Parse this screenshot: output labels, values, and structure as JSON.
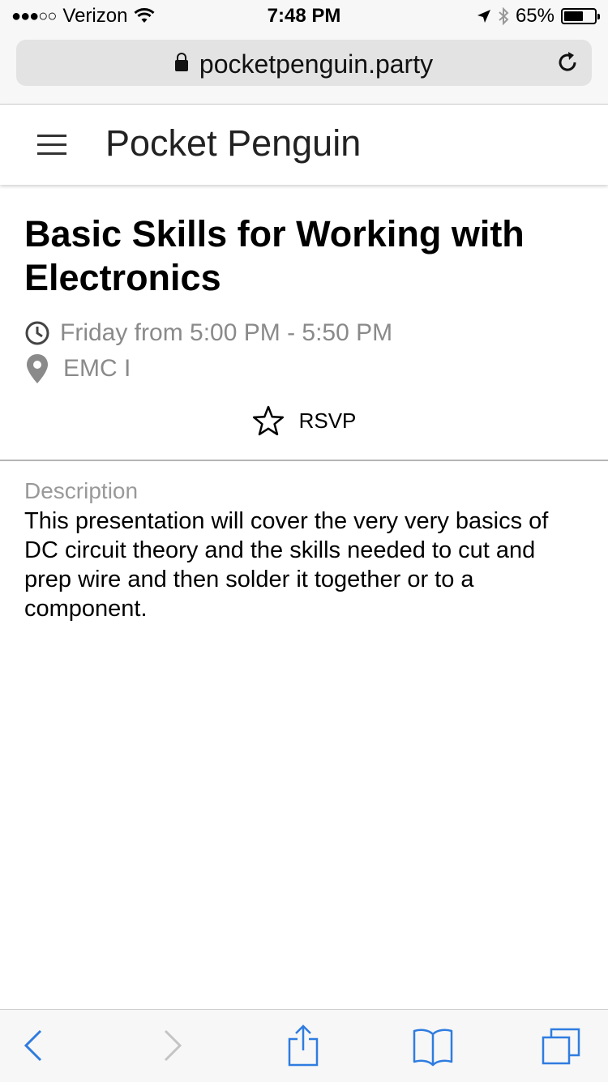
{
  "status_bar": {
    "signal": "●●●○○",
    "carrier": "Verizon",
    "time": "7:48 PM",
    "battery": "65%",
    "battery_level": 0.65
  },
  "browser": {
    "url": "pocketpenguin.party"
  },
  "app": {
    "title": "Pocket Penguin"
  },
  "event": {
    "title": "Basic Skills for Working with Electronics",
    "time": "Friday from 5:00 PM - 5:50 PM",
    "location": "EMC I",
    "rsvp_label": "RSVP"
  },
  "description": {
    "label": "Description",
    "text": "This presentation will cover the very very basics of DC circuit theory and the skills needed to cut and prep wire and then solder it together or to a component."
  },
  "colors": {
    "ios_blue": "#2f7ce0",
    "muted_gray": "#8a8a8a"
  }
}
